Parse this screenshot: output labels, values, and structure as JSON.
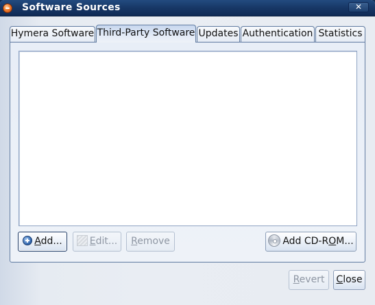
{
  "window": {
    "title": "Software Sources",
    "close_glyph": "✕"
  },
  "tabs": [
    {
      "label": "Hymera Software",
      "active": false
    },
    {
      "label": "Third-Party Software",
      "active": true
    },
    {
      "label": "Updates",
      "active": false
    },
    {
      "label": "Authentication",
      "active": false
    },
    {
      "label": "Statistics",
      "active": false
    }
  ],
  "source_list": {
    "items": []
  },
  "actions": {
    "add": {
      "underlined": "A",
      "rest": "dd..."
    },
    "edit": {
      "underlined": "E",
      "rest": "dit..."
    },
    "remove": {
      "underlined": "R",
      "rest": "emove"
    },
    "add_cdrom": {
      "pre": "Add CD-R",
      "underlined": "O",
      "rest": "M..."
    }
  },
  "footer": {
    "revert": {
      "underlined": "R",
      "rest": "evert"
    },
    "close": {
      "underlined": "C",
      "rest": "lose"
    }
  },
  "icons": {
    "app": "software-sources-icon",
    "add": "plus-icon",
    "edit": "edit-icon",
    "cdrom": "cdrom-icon",
    "close": "close-icon"
  },
  "colors": {
    "titlebar": "#173766",
    "window_bg": "#e8ecf2",
    "list_bg": "#ffffff"
  }
}
